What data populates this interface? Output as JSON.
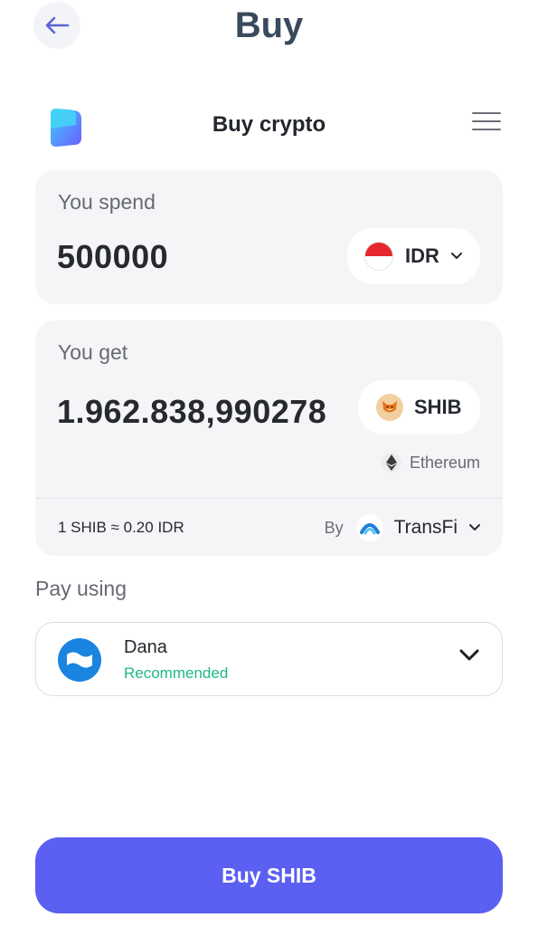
{
  "header": {
    "title": "Buy",
    "back_icon": "arrow-left-icon"
  },
  "widget": {
    "title": "Buy crypto",
    "logo_icon": "ramp-logo-icon",
    "menu_icon": "hamburger-menu-icon"
  },
  "spend": {
    "label": "You spend",
    "amount": "500000",
    "currency": "IDR",
    "currency_icon": "indonesia-flag-icon"
  },
  "get": {
    "label": "You get",
    "amount": "1.962.838,990278",
    "token": "SHIB",
    "token_icon": "shiba-inu-icon",
    "network": "Ethereum",
    "network_icon": "ethereum-icon"
  },
  "quote": {
    "rate": "1 SHIB ≈ 0.20 IDR",
    "by_label": "By",
    "provider": "TransFi",
    "provider_icon": "transfi-logo-icon"
  },
  "payment": {
    "label": "Pay using",
    "method": "Dana",
    "tag": "Recommended",
    "method_icon": "dana-logo-icon"
  },
  "cta": {
    "label": "Buy SHIB"
  },
  "colors": {
    "accent": "#5b5ff2",
    "recommended": "#1eb980",
    "card_bg": "#f5f5f7",
    "title": "#394a5c"
  }
}
